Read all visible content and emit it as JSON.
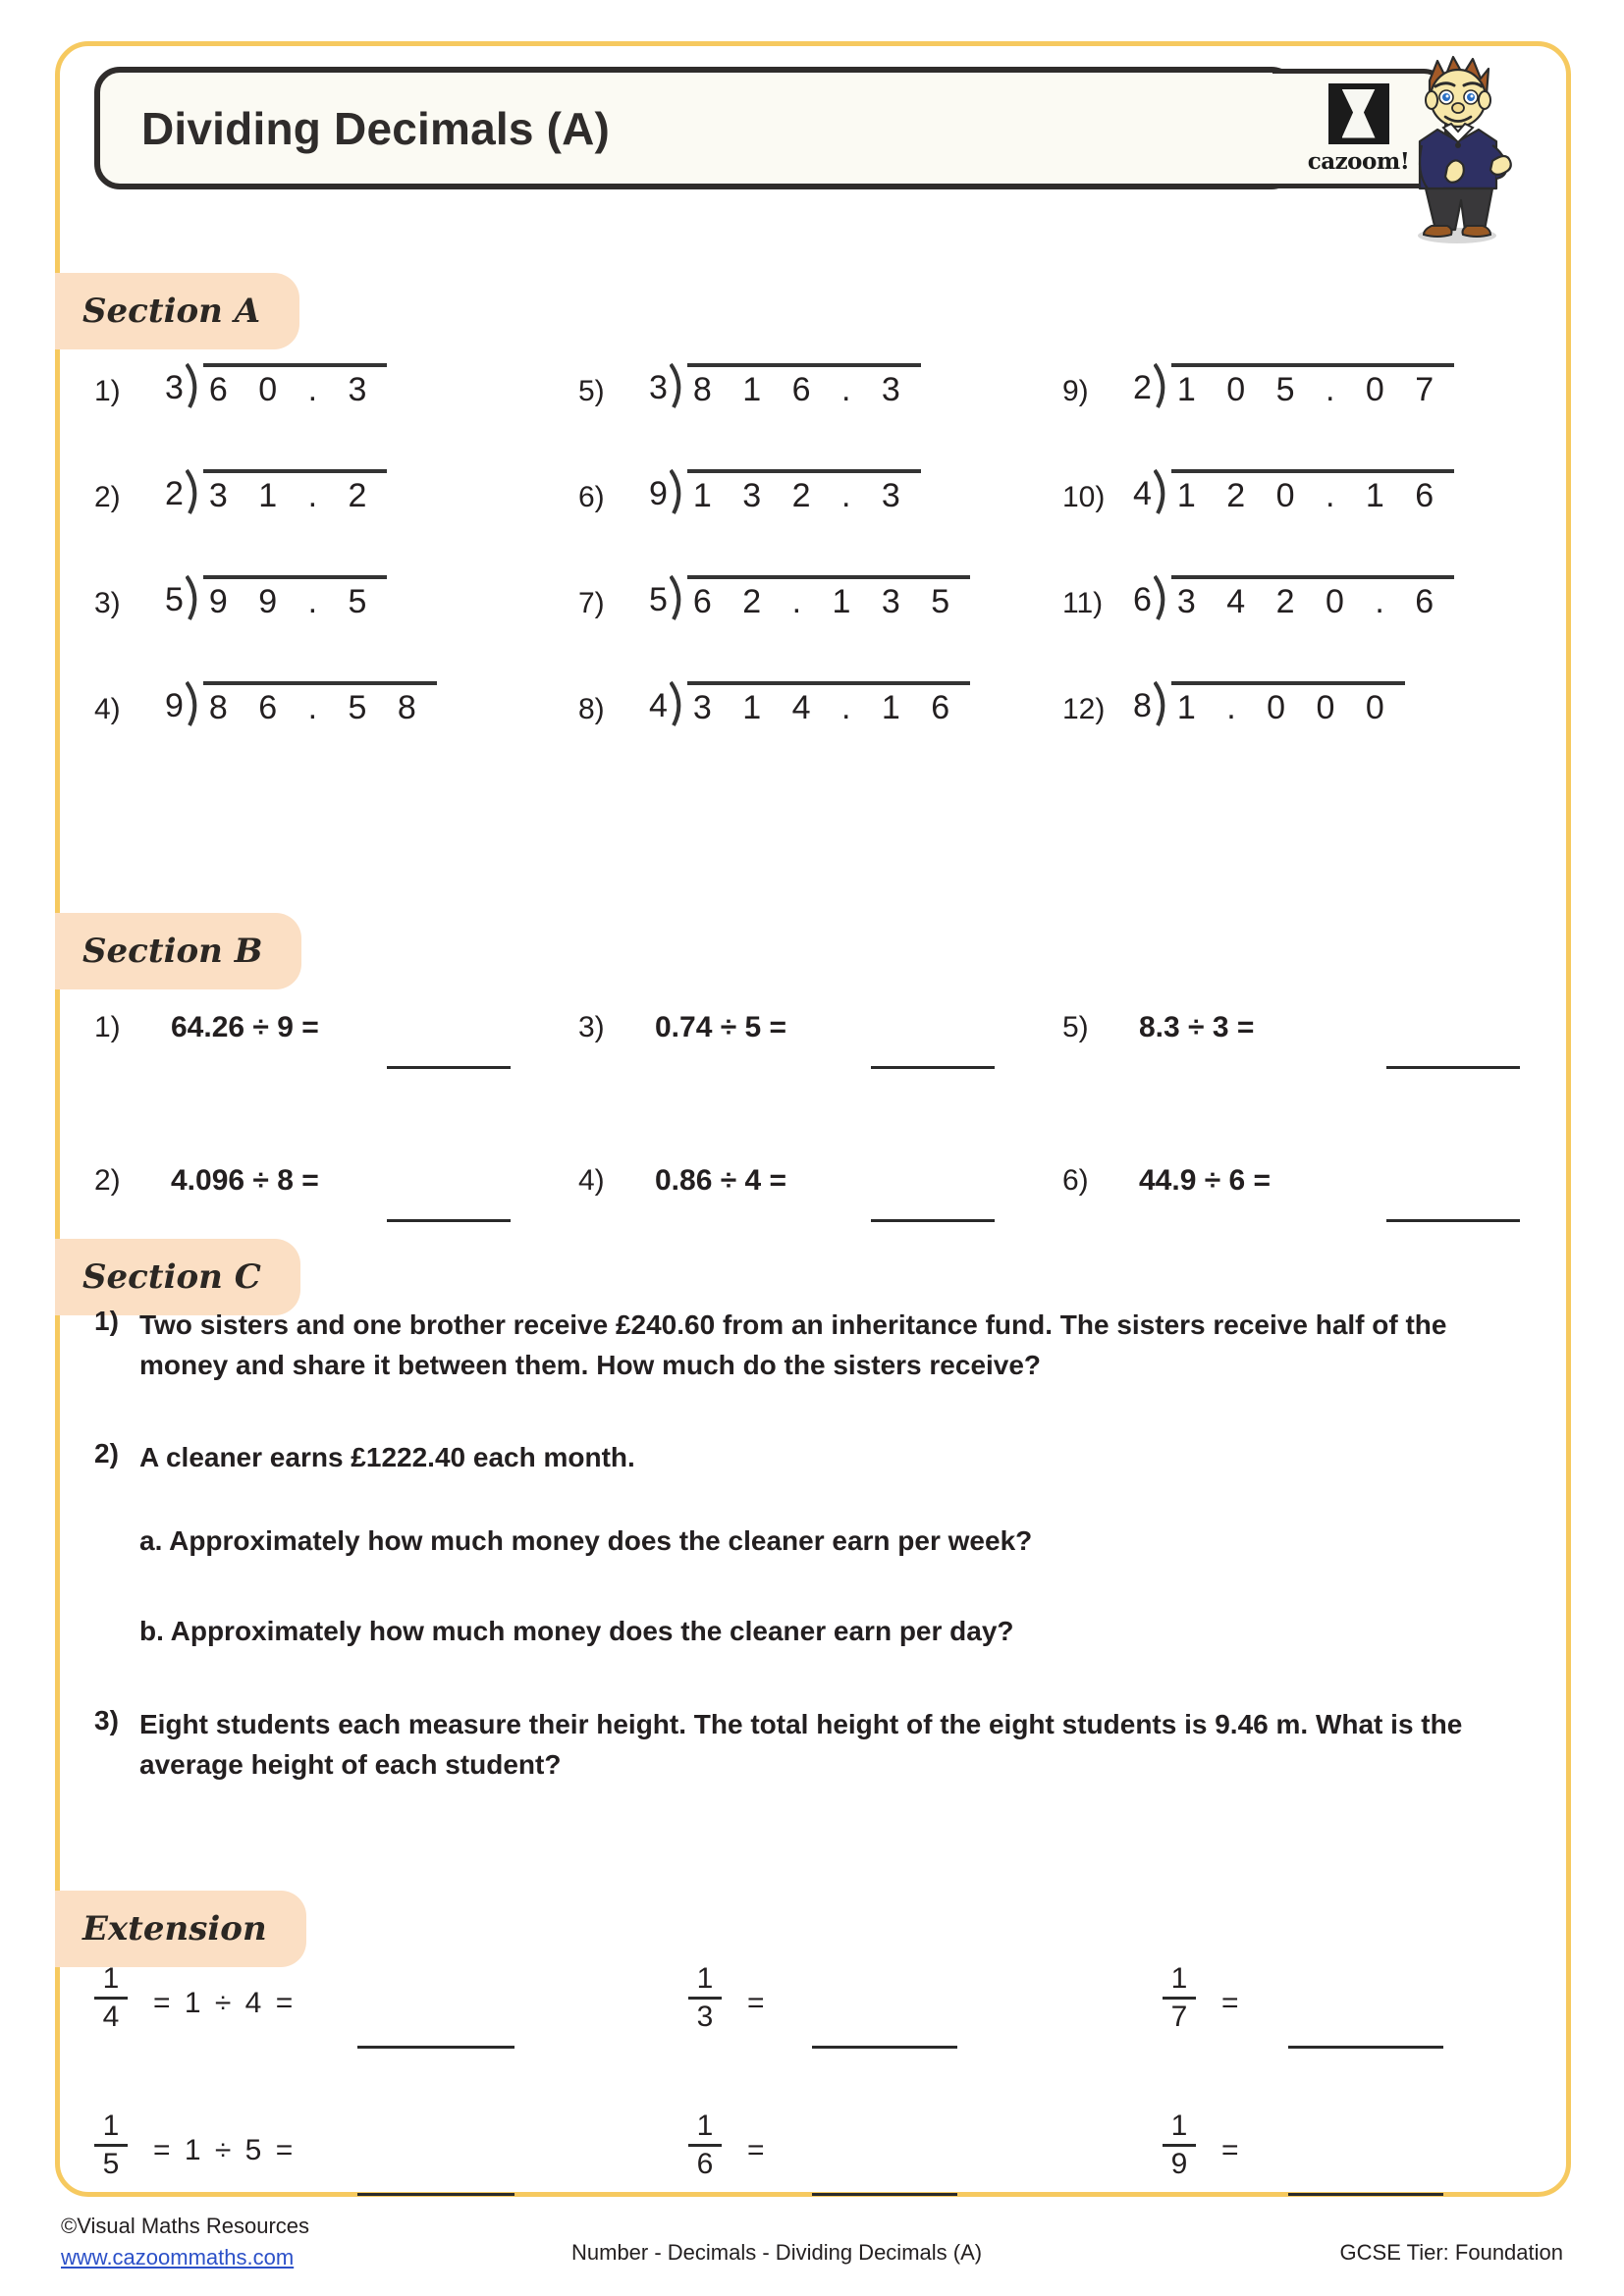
{
  "header": {
    "title": "Dividing Decimals (A)",
    "logo_word": "cazoom!",
    "logo_icon": "cazoom-hourglass-logo",
    "mascot_icon": "student-boy-thumbs-up-illustration"
  },
  "colors": {
    "page_border": "#f6c95f",
    "section_tag_bg": "#fbdfc4",
    "title_box_bg": "#fbfaf3",
    "title_border": "#2f2c2b",
    "ink": "#231f20",
    "link": "#2b50c8"
  },
  "sections": [
    {
      "tag": "Section A",
      "type": "long-division",
      "problems": [
        {
          "number": "1)",
          "divisor": "3",
          "dividend": "6 0 . 3"
        },
        {
          "number": "5)",
          "divisor": "3",
          "dividend": "8 1 6 . 3"
        },
        {
          "number": "9)",
          "divisor": "2",
          "dividend": "1 0 5 . 0 7"
        },
        {
          "number": "2)",
          "divisor": "2",
          "dividend": "3 1 . 2"
        },
        {
          "number": "6)",
          "divisor": "9",
          "dividend": "1 3 2 . 3"
        },
        {
          "number": "10)",
          "divisor": "4",
          "dividend": "1 2 0 . 1 6"
        },
        {
          "number": "3)",
          "divisor": "5",
          "dividend": "9 9 . 5"
        },
        {
          "number": "7)",
          "divisor": "5",
          "dividend": "6 2 . 1 3 5"
        },
        {
          "number": "11)",
          "divisor": "6",
          "dividend": "3 4 2 0 . 6"
        },
        {
          "number": "4)",
          "divisor": "9",
          "dividend": "8 6 . 5 8"
        },
        {
          "number": "8)",
          "divisor": "4",
          "dividend": "3 1 4 . 1 6"
        },
        {
          "number": "12)",
          "divisor": "8",
          "dividend": "1 . 0 0 0"
        }
      ]
    },
    {
      "tag": "Section B",
      "type": "inline-division",
      "problems": [
        {
          "number": "1)",
          "expression": "64.26 ÷ 9 ="
        },
        {
          "number": "3)",
          "expression": "0.74 ÷ 5 ="
        },
        {
          "number": "5)",
          "expression": "8.3 ÷ 3 ="
        },
        {
          "number": "2)",
          "expression": "4.096 ÷ 8 ="
        },
        {
          "number": "4)",
          "expression": "0.86 ÷ 4 ="
        },
        {
          "number": "6)",
          "expression": "44.9 ÷ 6 ="
        }
      ]
    },
    {
      "tag": "Section C",
      "type": "word-problems",
      "questions": [
        {
          "number": "1)",
          "text": "Two sisters and one brother receive £240.60 from an inheritance fund. The sisters receive half of the money and share it between them. How much do the sisters receive?",
          "parts": []
        },
        {
          "number": "2)",
          "text": "A cleaner earns £1222.40 each month.",
          "parts": [
            "a. Approximately how much money does the cleaner earn per week?",
            "b. Approximately how much money does the cleaner earn per day?"
          ]
        },
        {
          "number": "3)",
          "text": "Eight students each measure their height. The total height of the eight students is 9.46 m. What is the average height of  each student?",
          "parts": []
        }
      ]
    },
    {
      "tag": "Extension",
      "type": "fractions-to-decimals",
      "problems": [
        {
          "numerator": "1",
          "denominator": "4",
          "rhs": "= 1 ÷ 4 ="
        },
        {
          "numerator": "1",
          "denominator": "3",
          "rhs": "="
        },
        {
          "numerator": "1",
          "denominator": "7",
          "rhs": "="
        },
        {
          "numerator": "1",
          "denominator": "5",
          "rhs": "= 1 ÷ 5 ="
        },
        {
          "numerator": "1",
          "denominator": "6",
          "rhs": "="
        },
        {
          "numerator": "1",
          "denominator": "9",
          "rhs": "="
        }
      ]
    }
  ],
  "footer": {
    "copyright": "©Visual Maths Resources",
    "website": "www.cazoommaths.com",
    "topic": "Number - Decimals - Dividing Decimals (A)",
    "tier": "GCSE Tier: Foundation"
  }
}
